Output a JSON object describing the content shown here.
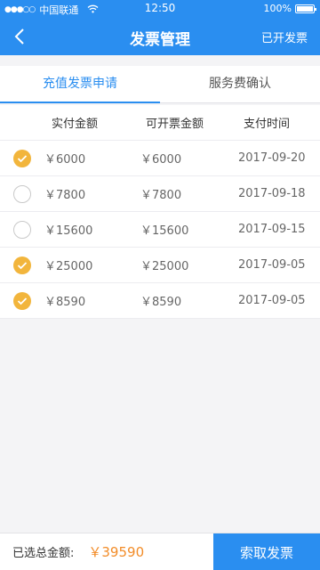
{
  "status_bar": {
    "signal": "●●●○○",
    "carrier": "中国联通",
    "wifi": "wifi-icon",
    "time": "12:50",
    "battery": "100%"
  },
  "nav": {
    "back_icon": "chevron-left-icon",
    "title": "发票管理",
    "right_label": "已开发票"
  },
  "tabs": [
    {
      "label": "充值发票申请",
      "active": true
    },
    {
      "label": "服务费确认",
      "active": false
    }
  ],
  "table": {
    "headers": [
      "实付金额",
      "可开票金额",
      "支付时间"
    ],
    "rows": [
      {
        "checked": true,
        "paid": "￥6000",
        "invoiceable": "￥6000",
        "date": "2017-09-20"
      },
      {
        "checked": false,
        "paid": "￥7800",
        "invoiceable": "￥7800",
        "date": "2017-09-18"
      },
      {
        "checked": false,
        "paid": "￥15600",
        "invoiceable": "￥15600",
        "date": "2017-09-15"
      },
      {
        "checked": true,
        "paid": "￥25000",
        "invoiceable": "￥25000",
        "date": "2017-09-05"
      },
      {
        "checked": true,
        "paid": "￥8590",
        "invoiceable": "￥8590",
        "date": "2017-09-05"
      }
    ]
  },
  "footer": {
    "total_label": "已选总金额:",
    "total_amount": "￥39590",
    "submit_label": "索取发票"
  },
  "colors": {
    "primary": "#2a8ef0",
    "checked": "#f2b53c",
    "amount": "#f28c28"
  }
}
